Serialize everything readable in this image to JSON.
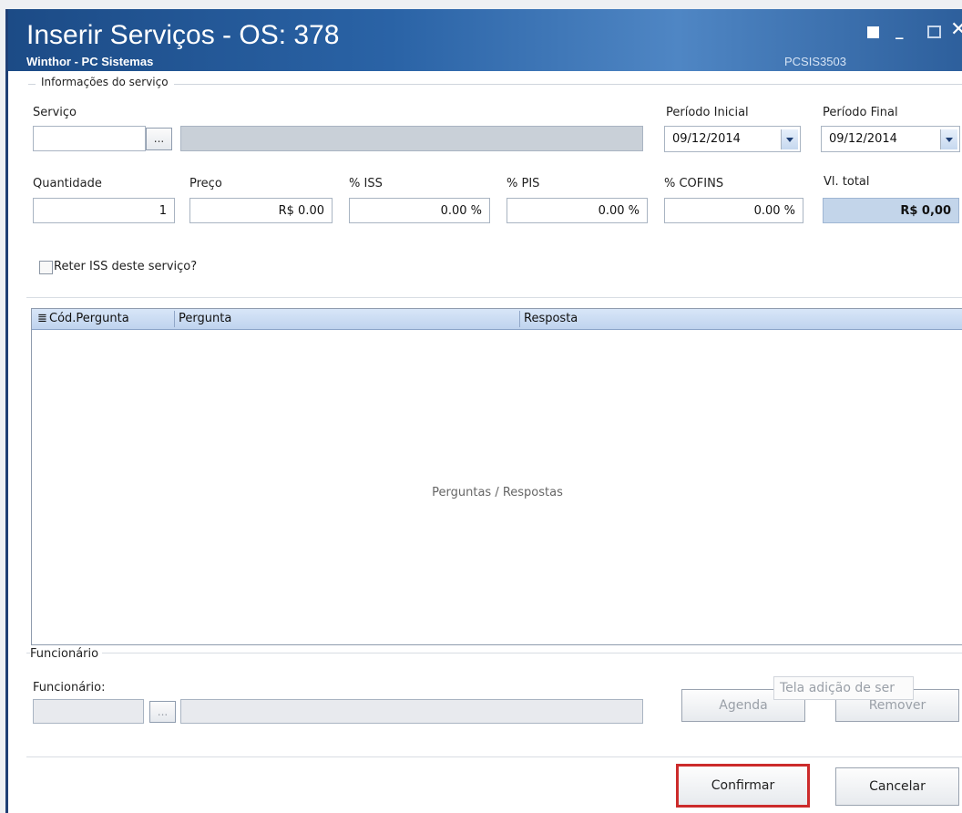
{
  "window": {
    "title": "Inserir Serviços - OS: 378",
    "subtitle": "Winthor - PC Sistemas",
    "code": "PCSIS3503"
  },
  "group_info": "Informações do serviço",
  "labels": {
    "servico": "Serviço",
    "periodo_inicial": "Período Inicial",
    "periodo_final": "Período Final",
    "quantidade": "Quantidade",
    "preco": "Preço",
    "iss": "% ISS",
    "pis": "% PIS",
    "cofins": "% COFINS",
    "vl_total": "Vl. total",
    "reter": "Reter ISS deste serviço?"
  },
  "fields": {
    "servico_code": "",
    "browse": "...",
    "servico_desc": "",
    "periodo_inicial": "09/12/2014",
    "periodo_final": "09/12/2014",
    "quantidade": "1",
    "preco": "R$ 0.00",
    "iss": "0.00 %",
    "pis": "0.00 %",
    "cofins": "0.00 %",
    "vl_total": "R$ 0,00"
  },
  "grid": {
    "columns": [
      "Cód.Pergunta",
      "Pergunta",
      "Resposta"
    ],
    "empty_text": "Perguntas / Respostas"
  },
  "funcionario": {
    "group": "Funcionário",
    "label": "Funcionário:",
    "code": "",
    "browse": "...",
    "name": ""
  },
  "buttons": {
    "agenda": "Agenda",
    "remover": "Remover",
    "tooltip": "Tela adição de ser",
    "confirmar": "Confirmar",
    "cancelar": "Cancelar"
  },
  "colors": {
    "title_bar": "#2a63a6",
    "highlight": "#cc2b2b",
    "total_bg": "#c3d5ea"
  }
}
